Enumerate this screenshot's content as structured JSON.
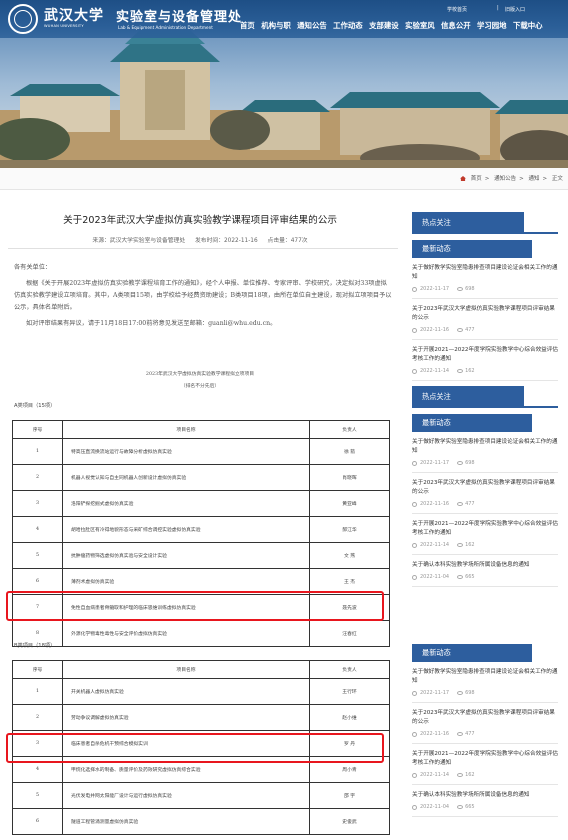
{
  "header": {
    "logo_cn": "武汉大学",
    "logo_en": "WUHAN UNIVERSITY",
    "dept_cn": "实验室与设备管理处",
    "dept_en": "Lab & Equipment Administration Department",
    "quick_links": [
      "学校首页",
      "旧版入口"
    ],
    "nav": [
      "首页",
      "机构与职",
      "通知公告",
      "工作动态",
      "支部建设",
      "实验室风",
      "信息公开",
      "学习园地",
      "下载中心"
    ]
  },
  "breadcrumb": [
    "首页",
    "通知公告",
    "通知",
    "正文"
  ],
  "article": {
    "title": "关于2023年武汉大学虚拟仿真实验教学课程项目评审结果的公示",
    "source": "来源：武汉大学实验室与设备管理处",
    "date": "发布时间：2022-11-16",
    "views": "点击量：477次",
    "greeting": "各有关单位：",
    "para1": "根据《关于开展2023年虚拟仿真实验教学课程培育工作的通知》，经个人申报、单位推荐、专家评审、学校研究，决定拟对33项虚拟仿真实验教学建设立项培育。其中，A类项目15项，由学校给予经费资助建设；B类项目18项，由所在单位自主建设，现对拟立项项目予以公示，具体名单附后。",
    "para2": "如对评审结果有异议，请于11月18日17:00前将意见发送至邮箱：guanli@whu.edu.cn。",
    "list_title": "2023年武汉大学虚拟仿真实验教学课程拟立项项目",
    "list_note": "（排名不分先后）",
    "cat_a": "A类项目（15项）",
    "cat_b": "B类项目（18项）",
    "header_row": [
      "序号",
      "项目名称",
      "负责人"
    ],
    "a_rows": [
      [
        "1",
        "特高压直流换流站运行与故障分析虚拟仿真实验",
        "徐  箭"
      ],
      [
        "2",
        "机器人视觉认知与自主同机器人创新设计虚拟仿真实验",
        "肖晓晖"
      ],
      [
        "3",
        "洛阳铲探挖掘式虚拟仿真实验",
        "黄亚峰"
      ],
      [
        "4",
        "胡哈拉肚区有冷得地貌形态与采矿综合调控实验虚拟仿真实验",
        "郝江华"
      ],
      [
        "5",
        "抗肿瘤药物筛选虚拟仿真实验与安全设计实验",
        "文  燕"
      ],
      [
        "6",
        "薄剂术虚拟仿真实验",
        "王  杰"
      ],
      [
        "7",
        "免性自血病患者骨髓取和护理的临床思维训练虚拟仿真实验",
        "聂先波"
      ],
      [
        "8",
        "外源化学物毒性毒性与安全评价虚拟仿真实验",
        "汪春红"
      ]
    ],
    "b_rows": [
      [
        "1",
        "开关机器人虚拟仿真实验",
        "王行环"
      ],
      [
        "2",
        "劳动争议调解虚拟仿真实验",
        "赵小维"
      ],
      [
        "3",
        "临床患者自杀危机干预综合模拟实训",
        "罗  丹"
      ],
      [
        "4",
        "甲烷化选择水的制备、质量评价及药效研究虚拟仿真综合实验",
        "周小青"
      ],
      [
        "5",
        "光伏发电并网太阳能厂设计与运行虚拟仿真实验",
        "邵  宇"
      ],
      [
        "6",
        "隧道工程管涌测量虚拟仿真实验",
        "史俊武"
      ]
    ]
  },
  "sidebar": {
    "hot_label": "热点关注",
    "latest_label": "最新动态",
    "news": [
      {
        "title": "关于做好教学实验室隐患排查项目建设论证会相关工作的通知",
        "date": "2022-11-17",
        "views": "698"
      },
      {
        "title": "关于2023年武汉大学虚拟仿真实验教学课程项目评审结果的公示",
        "date": "2022-11-16",
        "views": "477"
      },
      {
        "title": "关于开展2021—2022年度学院实验教学中心综合效益评估考核工作的通知",
        "date": "2022-11-14",
        "views": "162"
      },
      {
        "title": "关于确认本科实验教学场所所属设备信息的通知",
        "date": "2022-11-04",
        "views": "665"
      }
    ]
  },
  "highlight_color": "#e8161e",
  "accent_color": "#2d5e9e"
}
